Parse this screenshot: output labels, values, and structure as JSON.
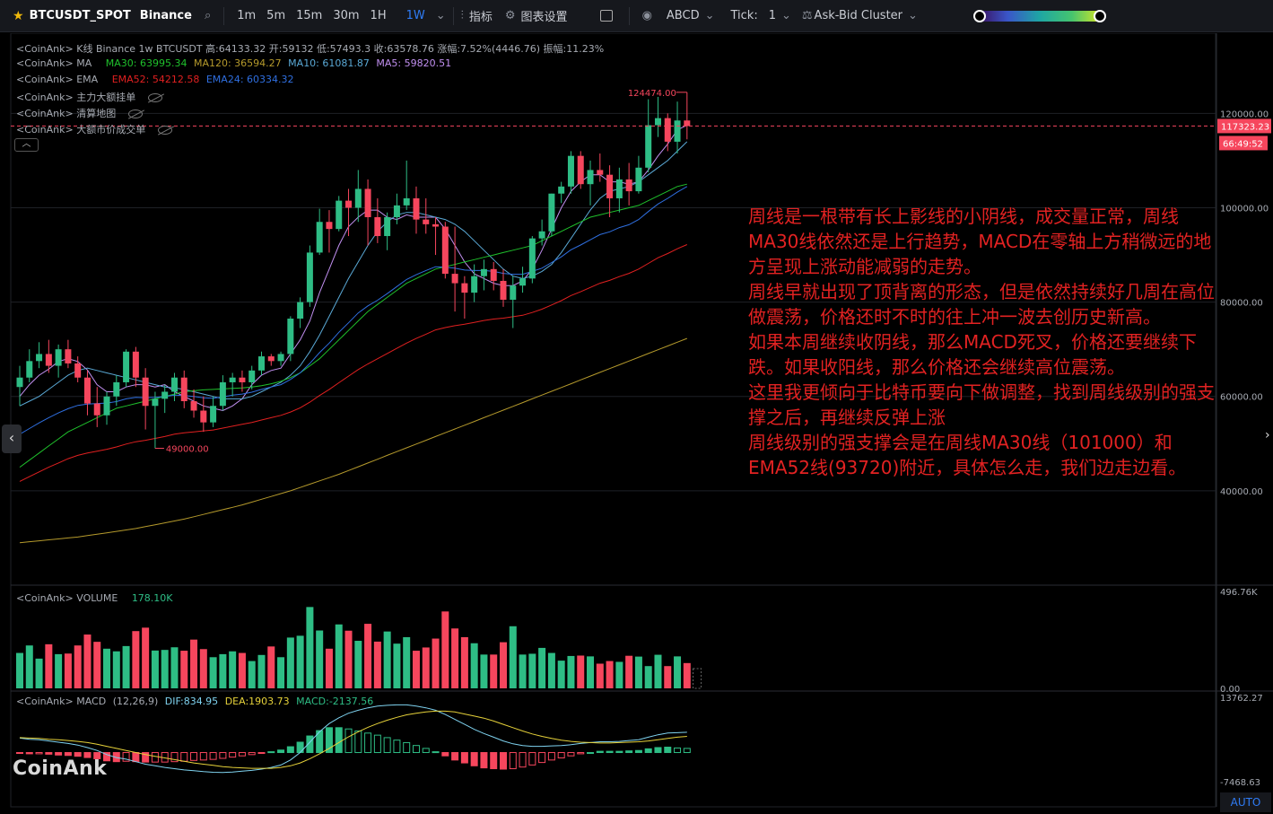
{
  "toolbar": {
    "symbol": "BTCUSDT_SPOT",
    "exchange": "Binance",
    "intervals": [
      "1m",
      "5m",
      "15m",
      "30m",
      "1H",
      "1W"
    ],
    "active_interval": "1W",
    "indicators_label": "指标",
    "chart_settings_label": "图表设置",
    "abcd_label": "ABCD",
    "tick_label": "Tick:",
    "tick_value": "1",
    "cluster_label": "Ask-Bid Cluster",
    "accent_color": "#2f7cf6",
    "star_color": "#f0b90b"
  },
  "legend": {
    "kline": "<CoinAnk> K线  Binance 1w BTCUSDT 高:64133.32  开:59132  低:57493.3  收:63578.76  涨幅:7.52%(4446.76)  振幅:11.23%",
    "ma_prefix": "<CoinAnk> MA",
    "ma30": "MA30: 63995.34",
    "ma120": "MA120: 36594.27",
    "ma10": "MA10: 61081.87",
    "ma5": "MA5: 59820.51",
    "ema_prefix": "<CoinAnk> EMA",
    "ema52": "EMA52: 54212.58",
    "ema24": "EMA24: 60334.32",
    "layer1": "<CoinAnk> 主力大额挂单",
    "layer2": "<CoinAnk> 清算地图",
    "layer3": "<CoinAnk> 大额市价成交单",
    "volume": "<CoinAnk> VOLUME",
    "volume_value": "178.10K",
    "macd": "<CoinAnk> MACD",
    "macd_params": "(12,26,9)",
    "dif": "DIF:834.95",
    "dea": "DEA:1903.73",
    "macd_value": "MACD:-2137.56"
  },
  "price_axis": {
    "ticks": [
      "120000.00",
      "100000.00",
      "80000.00",
      "60000.00",
      "40000.00"
    ],
    "current_price": "117323.23",
    "countdown": "66:49:52",
    "high_marker": "124474.00",
    "low_marker": "49000.00"
  },
  "volume_axis": {
    "ticks": [
      "496.76K",
      "0.00"
    ]
  },
  "macd_axis": {
    "ticks": [
      "13762.27",
      "-7468.63"
    ]
  },
  "note": [
    "周线是一根带有长上影线的小阴线，成交量正常，周线MA30线依然还是上行趋势，MACD在零轴上方稍微远的地方呈现上涨动能减弱的走势。",
    "周线早就出现了顶背离的形态，但是依然持续好几周在高位做震荡，价格还时不时的往上冲一波去创历史新高。",
    "如果本周继续收阴线，那么MACD死叉，价格还要继续下跌。如果收阳线，那么价格还会继续高位震荡。",
    "这里我更倾向于比特币要向下做调整，找到周线级别的强支撑之后，再继续反弹上涨",
    "周线级别的强支撑会是在周线MA30线（101000）和EMA52线(93720)附近，具体怎么走，我们边走边看。"
  ],
  "watermark": "CoinAnk",
  "auto_label": "AUTO",
  "colors": {
    "up": "#26a69a",
    "up_fill": "#2ebd85",
    "down": "#f6465d",
    "ma5": "#c18ff0",
    "ma10": "#5aa9d6",
    "ma30": "#1fc12c",
    "ma120": "#b59a2c",
    "ema24": "#2f6fe0",
    "ema52": "#e02020",
    "dif": "#7fd3f0",
    "dea": "#e6d23a",
    "note": "#e22222"
  },
  "chart_data": {
    "type": "candlestick",
    "interval": "1w",
    "price_ylim": [
      20000,
      137000
    ],
    "candles": [
      [
        62000,
        66500,
        58000,
        64000
      ],
      [
        64000,
        70000,
        63000,
        67500
      ],
      [
        67500,
        71500,
        66000,
        69000
      ],
      [
        69000,
        72000,
        65000,
        66500
      ],
      [
        66500,
        71000,
        64000,
        70000
      ],
      [
        70000,
        72000,
        66000,
        67000
      ],
      [
        67000,
        68500,
        63000,
        64000
      ],
      [
        64000,
        65500,
        56000,
        58500
      ],
      [
        58500,
        62000,
        53500,
        56000
      ],
      [
        56000,
        61000,
        54000,
        60000
      ],
      [
        60000,
        64500,
        58000,
        63000
      ],
      [
        63000,
        70000,
        62000,
        69500
      ],
      [
        69500,
        70500,
        62000,
        64000
      ],
      [
        64000,
        66000,
        53000,
        58000
      ],
      [
        58000,
        61000,
        49000,
        59500
      ],
      [
        59500,
        62500,
        56500,
        61000
      ],
      [
        61000,
        65000,
        59000,
        64000
      ],
      [
        64000,
        65500,
        57500,
        59000
      ],
      [
        59000,
        61500,
        55500,
        57000
      ],
      [
        57000,
        60000,
        52500,
        54500
      ],
      [
        54500,
        60000,
        53500,
        58000
      ],
      [
        58000,
        64500,
        57000,
        63000
      ],
      [
        63000,
        65000,
        60000,
        64000
      ],
      [
        64000,
        65500,
        61000,
        63000
      ],
      [
        63000,
        66500,
        61500,
        65500
      ],
      [
        65500,
        69500,
        64500,
        68500
      ],
      [
        68500,
        69000,
        66500,
        67500
      ],
      [
        67500,
        69500,
        66500,
        69000
      ],
      [
        69000,
        77000,
        67500,
        76500
      ],
      [
        76500,
        81000,
        74500,
        80000
      ],
      [
        80000,
        92000,
        79000,
        90500
      ],
      [
        90500,
        99800,
        90000,
        97000
      ],
      [
        97000,
        99500,
        90500,
        95500
      ],
      [
        95500,
        102500,
        95000,
        101500
      ],
      [
        101500,
        104000,
        94000,
        100000
      ],
      [
        100000,
        108000,
        97000,
        104000
      ],
      [
        104000,
        106000,
        92000,
        98000
      ],
      [
        98000,
        102000,
        92500,
        94000
      ],
      [
        94000,
        99000,
        91000,
        98000
      ],
      [
        98000,
        103000,
        96500,
        100500
      ],
      [
        100500,
        110000,
        99500,
        102000
      ],
      [
        102000,
        104500,
        94500,
        97500
      ],
      [
        97500,
        102000,
        94500,
        96500
      ],
      [
        96500,
        98000,
        90000,
        96000
      ],
      [
        96000,
        97000,
        85000,
        86000
      ],
      [
        86000,
        96000,
        78000,
        84000
      ],
      [
        84000,
        85500,
        76500,
        82000
      ],
      [
        82000,
        88000,
        80000,
        85500
      ],
      [
        85500,
        89000,
        82500,
        87000
      ],
      [
        87000,
        88500,
        82500,
        84500
      ],
      [
        84500,
        87000,
        79000,
        80500
      ],
      [
        80500,
        85500,
        74500,
        83500
      ],
      [
        83500,
        87500,
        82000,
        85000
      ],
      [
        85000,
        94000,
        84000,
        93500
      ],
      [
        93500,
        97500,
        92000,
        95000
      ],
      [
        95000,
        103000,
        94000,
        103000
      ],
      [
        103000,
        105500,
        101000,
        104500
      ],
      [
        104500,
        112000,
        103000,
        111000
      ],
      [
        111000,
        112000,
        104000,
        105000
      ],
      [
        105000,
        110000,
        100500,
        108000
      ],
      [
        108000,
        111500,
        105500,
        107000
      ],
      [
        107000,
        109000,
        98000,
        102000
      ],
      [
        102000,
        108500,
        99000,
        106000
      ],
      [
        106000,
        109500,
        100500,
        103500
      ],
      [
        103500,
        111000,
        103000,
        108500
      ],
      [
        108500,
        123000,
        107500,
        117500
      ],
      [
        117500,
        123500,
        115000,
        119000
      ],
      [
        119000,
        120000,
        112000,
        114000
      ],
      [
        114000,
        122500,
        111500,
        118500
      ],
      [
        118500,
        124474,
        114500,
        117323.23
      ]
    ],
    "volume": [
      175,
      212,
      147,
      218,
      169,
      172,
      212,
      266,
      230,
      196,
      183,
      209,
      283,
      300,
      187,
      190,
      203,
      186,
      241,
      194,
      154,
      169,
      183,
      175,
      135,
      165,
      207,
      154,
      251,
      260,
      402,
      286,
      196,
      316,
      285,
      235,
      319,
      231,
      281,
      221,
      253,
      186,
      202,
      246,
      380,
      296,
      253,
      223,
      167,
      167,
      228,
      307,
      167,
      171,
      200,
      175,
      137,
      160,
      162,
      158,
      122,
      135,
      131,
      161,
      157,
      110,
      166,
      110,
      158,
      125
    ],
    "volume_ylim": [
      0,
      496.76
    ],
    "dif": [
      3500,
      3200,
      3100,
      2800,
      2500,
      2200,
      1800,
      1200,
      500,
      -500,
      -1200,
      -1600,
      -2200,
      -2800,
      -3200,
      -3600,
      -3900,
      -4200,
      -4400,
      -4600,
      -4750,
      -4800,
      -4700,
      -4500,
      -4300,
      -4000,
      -3600,
      -3000,
      -1800,
      0,
      2500,
      5000,
      7000,
      8400,
      9500,
      10200,
      10800,
      11200,
      11400,
      11500,
      11500,
      11200,
      10800,
      10200,
      9200,
      8000,
      6800,
      5600,
      4600,
      3700,
      2800,
      2100,
      1700,
      1500,
      1500,
      1600,
      1700,
      1900,
      2200,
      2400,
      2600,
      2600,
      2700,
      2900,
      3100,
      3700,
      4300,
      4700,
      4800,
      4900
    ],
    "dea": [
      3600,
      3500,
      3400,
      3200,
      3100,
      2900,
      2700,
      2400,
      2000,
      1500,
      1000,
      500,
      0,
      -500,
      -900,
      -1300,
      -1700,
      -2100,
      -2500,
      -2800,
      -3100,
      -3400,
      -3600,
      -3700,
      -3800,
      -3800,
      -3800,
      -3600,
      -3200,
      -2500,
      -1500,
      -300,
      1000,
      2400,
      3800,
      5000,
      6100,
      7000,
      7800,
      8500,
      9100,
      9500,
      9800,
      10000,
      10000,
      9800,
      9300,
      8800,
      8300,
      7600,
      6800,
      6000,
      5200,
      4500,
      3900,
      3400,
      3000,
      2700,
      2500,
      2400,
      2300,
      2300,
      2400,
      2500,
      2600,
      2800,
      3100,
      3400,
      3700,
      3900
    ],
    "macd_ylim": [
      -7468.63,
      13762.27
    ],
    "ma_lines": [
      {
        "name": "MA5",
        "values": [
          60000,
          62500,
          64500,
          65800,
          67400,
          68000,
          67400,
          65600,
          62500,
          61000,
          61000,
          62000,
          62500,
          62500,
          62000,
          62500,
          61000,
          60000,
          59000,
          58000,
          57500,
          57000,
          58000,
          59500,
          62500,
          64500,
          65500,
          66000,
          69000,
          72000,
          76000,
          82000,
          87000,
          92000,
          96000,
          98000,
          99500,
          99500,
          98000,
          97500,
          98500,
          98000,
          98000,
          98000,
          95500,
          92000,
          88500,
          86000,
          85000,
          84000,
          83500,
          83500,
          84500,
          87000,
          91000,
          95500,
          100000,
          103500,
          105500,
          107000,
          107000,
          105500,
          105500,
          105000,
          105500,
          108000,
          111000,
          113500,
          116500,
          117500
        ]
      },
      {
        "name": "MA10",
        "values": [
          58000,
          59000,
          60000,
          61500,
          63000,
          64500,
          65500,
          66000,
          65500,
          65000,
          64500,
          64000,
          63500,
          63000,
          62500,
          62000,
          61800,
          61500,
          61000,
          60500,
          60000,
          59500,
          59500,
          59500,
          60000,
          61000,
          62000,
          63000,
          64500,
          66500,
          69500,
          73000,
          77000,
          81000,
          85000,
          88500,
          92000,
          95000,
          97000,
          98500,
          99000,
          99000,
          98500,
          98000,
          97500,
          96500,
          95000,
          93000,
          91000,
          89000,
          87000,
          85500,
          85000,
          85500,
          86500,
          88000,
          90500,
          93500,
          96500,
          99500,
          102000,
          103500,
          104000,
          104500,
          105500,
          107000,
          108500,
          110000,
          112000,
          114000
        ]
      },
      {
        "name": "MA30",
        "values": [
          45000,
          46500,
          48000,
          49500,
          51000,
          52500,
          53500,
          54500,
          55500,
          56500,
          57500,
          58000,
          58500,
          59000,
          59500,
          60000,
          60500,
          61000,
          61200,
          61400,
          61500,
          61600,
          61700,
          61800,
          62000,
          62300,
          62700,
          63200,
          64000,
          65000,
          66500,
          68000,
          70000,
          72000,
          74000,
          76000,
          78000,
          79500,
          81000,
          82500,
          84000,
          85000,
          86000,
          87000,
          87500,
          88000,
          88500,
          89000,
          89500,
          90000,
          90500,
          91000,
          91500,
          92000,
          93000,
          94000,
          95000,
          96000,
          97000,
          98000,
          98500,
          99000,
          99500,
          100000,
          100500,
          101500,
          102500,
          103500,
          104500,
          105000
        ]
      },
      {
        "name": "MA120",
        "values": [
          29000,
          29200,
          29400,
          29600,
          29800,
          30000,
          30200,
          30500,
          30800,
          31100,
          31400,
          31700,
          32000,
          32400,
          32800,
          33200,
          33600,
          34000,
          34500,
          35000,
          35500,
          36000,
          36500,
          37000,
          37600,
          38200,
          38800,
          39400,
          40000,
          40700,
          41400,
          42100,
          42800,
          43500,
          44300,
          45100,
          45900,
          46700,
          47500,
          48300,
          49100,
          49900,
          50700,
          51500,
          52300,
          53100,
          53900,
          54700,
          55500,
          56300,
          57100,
          57900,
          58700,
          59500,
          60300,
          61100,
          61900,
          62700,
          63500,
          64300,
          65100,
          65900,
          66700,
          67500,
          68300,
          69100,
          69900,
          70700,
          71500,
          72300
        ]
      }
    ],
    "ema_lines": [
      {
        "name": "EMA24",
        "values": [
          52000,
          53200,
          54400,
          55500,
          56500,
          57400,
          58100,
          58400,
          58500,
          58600,
          58900,
          59500,
          59800,
          59700,
          59800,
          60000,
          60300,
          60200,
          60000,
          59700,
          59600,
          59900,
          60300,
          60500,
          60900,
          61500,
          62000,
          62500,
          63600,
          65000,
          67000,
          69300,
          71300,
          73600,
          75600,
          77700,
          79200,
          80400,
          81800,
          83300,
          84800,
          85800,
          86700,
          87500,
          87400,
          87200,
          86800,
          86700,
          86700,
          86500,
          86100,
          85900,
          85900,
          86500,
          87200,
          88400,
          89600,
          91100,
          92100,
          93200,
          94300,
          94900,
          95800,
          96400,
          97500,
          99200,
          100800,
          102000,
          103300,
          104500
        ]
      },
      {
        "name": "EMA52",
        "values": [
          42000,
          43000,
          44000,
          45000,
          45900,
          46800,
          47500,
          48000,
          48400,
          48800,
          49300,
          49900,
          50400,
          50700,
          51100,
          51500,
          52000,
          52300,
          52500,
          52700,
          52900,
          53300,
          53700,
          54100,
          54500,
          55000,
          55500,
          56000,
          56700,
          57600,
          58800,
          60200,
          61500,
          62900,
          64300,
          65700,
          66900,
          68000,
          69100,
          70200,
          71300,
          72300,
          73200,
          74100,
          74600,
          75000,
          75300,
          75700,
          76100,
          76400,
          76600,
          76900,
          77200,
          77800,
          78500,
          79400,
          80300,
          81400,
          82200,
          83100,
          84000,
          84600,
          85400,
          86100,
          87000,
          88200,
          89400,
          90300,
          91300,
          92200
        ]
      }
    ]
  }
}
